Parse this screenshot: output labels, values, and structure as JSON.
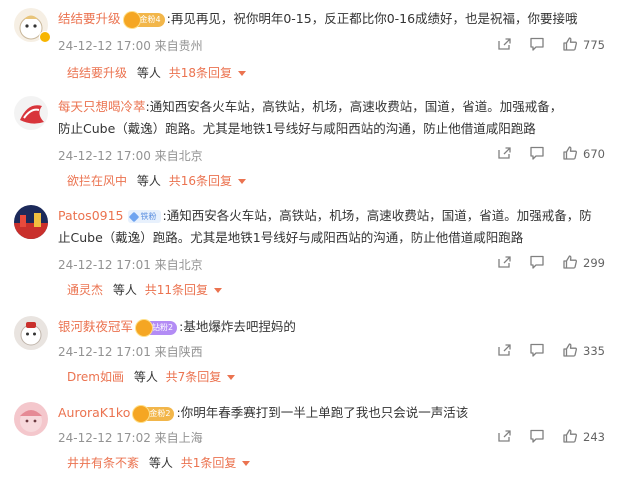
{
  "comments": [
    {
      "username": "结结要升级",
      "badge": "金粉4",
      "text": ":再见再见，祝你明年0-15，反正都比你0-16成绩好，也是祝福，你要接哦",
      "meta": "24-12-12 17:00 来自贵州",
      "likes": "775",
      "reply_name": "结结要升级",
      "reply_mid": "等人",
      "reply_count": "共18条回复"
    },
    {
      "username": "每天只想喝冷萃",
      "badge": "",
      "text_line1": ":通知西安各火车站，高铁站，机场，高速收费站，国道，省道。加强戒备，",
      "text_line2": "防止Cube（戴逸）跑路。尤其是地铁1号线好与咸阳西站的沟通，防止他借道咸阳跑路",
      "meta": "24-12-12 17:00 来自北京",
      "likes": "670",
      "reply_name": "欲拦在风中",
      "reply_mid": "等人",
      "reply_count": "共16条回复"
    },
    {
      "username": "Patos0915",
      "badge": "铁粉",
      "text_line1": ":通知西安各火车站，高铁站，机场，高速收费站，国道，省道。加强戒备，防",
      "text_line2": "止Cube（戴逸）跑路。尤其是地铁1号线好与咸阳西站的沟通，防止他借道咸阳跑路",
      "meta": "24-12-12 17:01 来自北京",
      "likes": "299",
      "reply_name": "通灵杰",
      "reply_mid": "等人",
      "reply_count": "共11条回复"
    },
    {
      "username": "银河麩夜冠军",
      "badge": "钻粉2",
      "text": ":基地爆炸去吧捏妈的",
      "meta": "24-12-12 17:01 来自陕西",
      "likes": "335",
      "reply_name": "Drem如画",
      "reply_mid": "等人",
      "reply_count": "共7条回复"
    },
    {
      "username": "AuroraK1ko",
      "badge": "金粉2",
      "text": ":你明年春季赛打到一半上单跑了我也只会说一声活该",
      "meta": "24-12-12 17:02 来自上海",
      "likes": "243",
      "reply_name": "井井有条不紊",
      "reply_mid": "等人",
      "reply_count": "共1条回复"
    }
  ],
  "icons": {
    "share": "share-icon",
    "comment": "comment-icon",
    "like": "like-icon"
  },
  "colors": {
    "username": "#eb7350",
    "meta": "#939393",
    "text": "#333333"
  }
}
